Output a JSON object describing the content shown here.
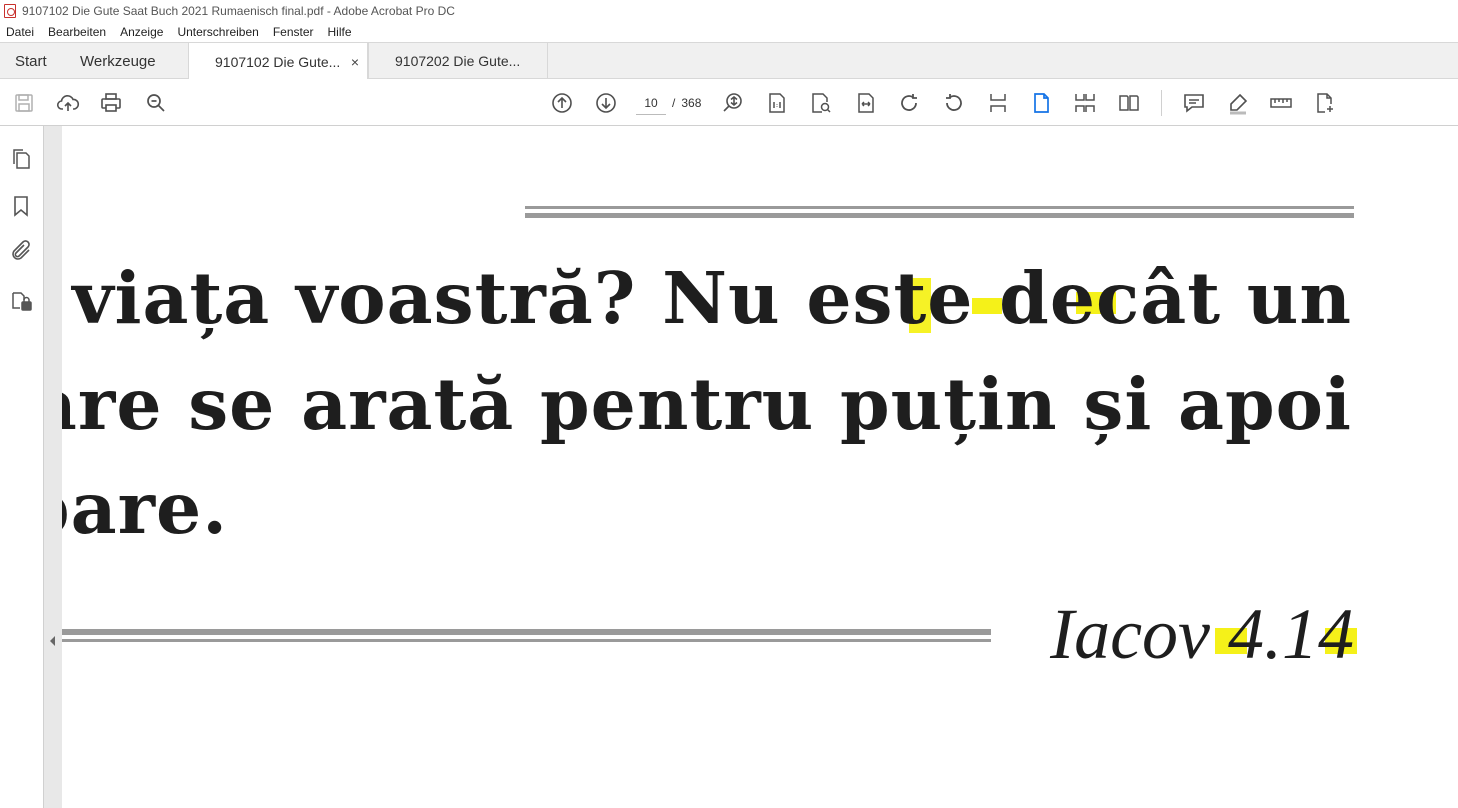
{
  "window": {
    "title": "9107102  Die Gute Saat Buch 2021 Rumaenisch final.pdf - Adobe Acrobat Pro DC"
  },
  "menubar": {
    "items": [
      "Datei",
      "Bearbeiten",
      "Anzeige",
      "Unterschreiben",
      "Fenster",
      "Hilfe"
    ]
  },
  "tabs": {
    "home": "Start",
    "tools": "Werkzeuge",
    "docs": [
      {
        "label": "9107102  Die Gute...",
        "close": "×",
        "active": true
      },
      {
        "label": "9107202  Die Gute...",
        "active": false
      }
    ]
  },
  "toolbar": {
    "left_icons": [
      "save-icon",
      "upload-cloud-icon",
      "print-icon",
      "find-zoom-icon"
    ],
    "page_current": "10",
    "page_separator": "/",
    "page_total": "368",
    "right_icons": [
      "page-up-icon",
      "page-down-icon",
      "zoom-tool-icon",
      "actual-size-icon",
      "zoom-page-icon",
      "fit-width-icon",
      "rotate-clockwise-icon",
      "rotate-counterclockwise-icon",
      "scroll-mode-icon",
      "single-page-icon",
      "two-page-scroll-icon",
      "two-page-icon",
      "comment-icon",
      "highlight-icon",
      "measure-icon",
      "export-pdf-icon"
    ]
  },
  "navpane": {
    "icons": [
      "page-thumbnails-icon",
      "bookmarks-icon",
      "attachments-icon",
      "security-icon"
    ]
  },
  "document": {
    "lines": [
      "este viața voastră? Nu este decât un",
      ", care se arată pentru puțin și apoi",
      "pare."
    ],
    "reference": "Iacov 4.14"
  },
  "colors": {
    "accent": "#1473e6",
    "highlight": "#f4f000",
    "rule": "#9a9a9a"
  }
}
